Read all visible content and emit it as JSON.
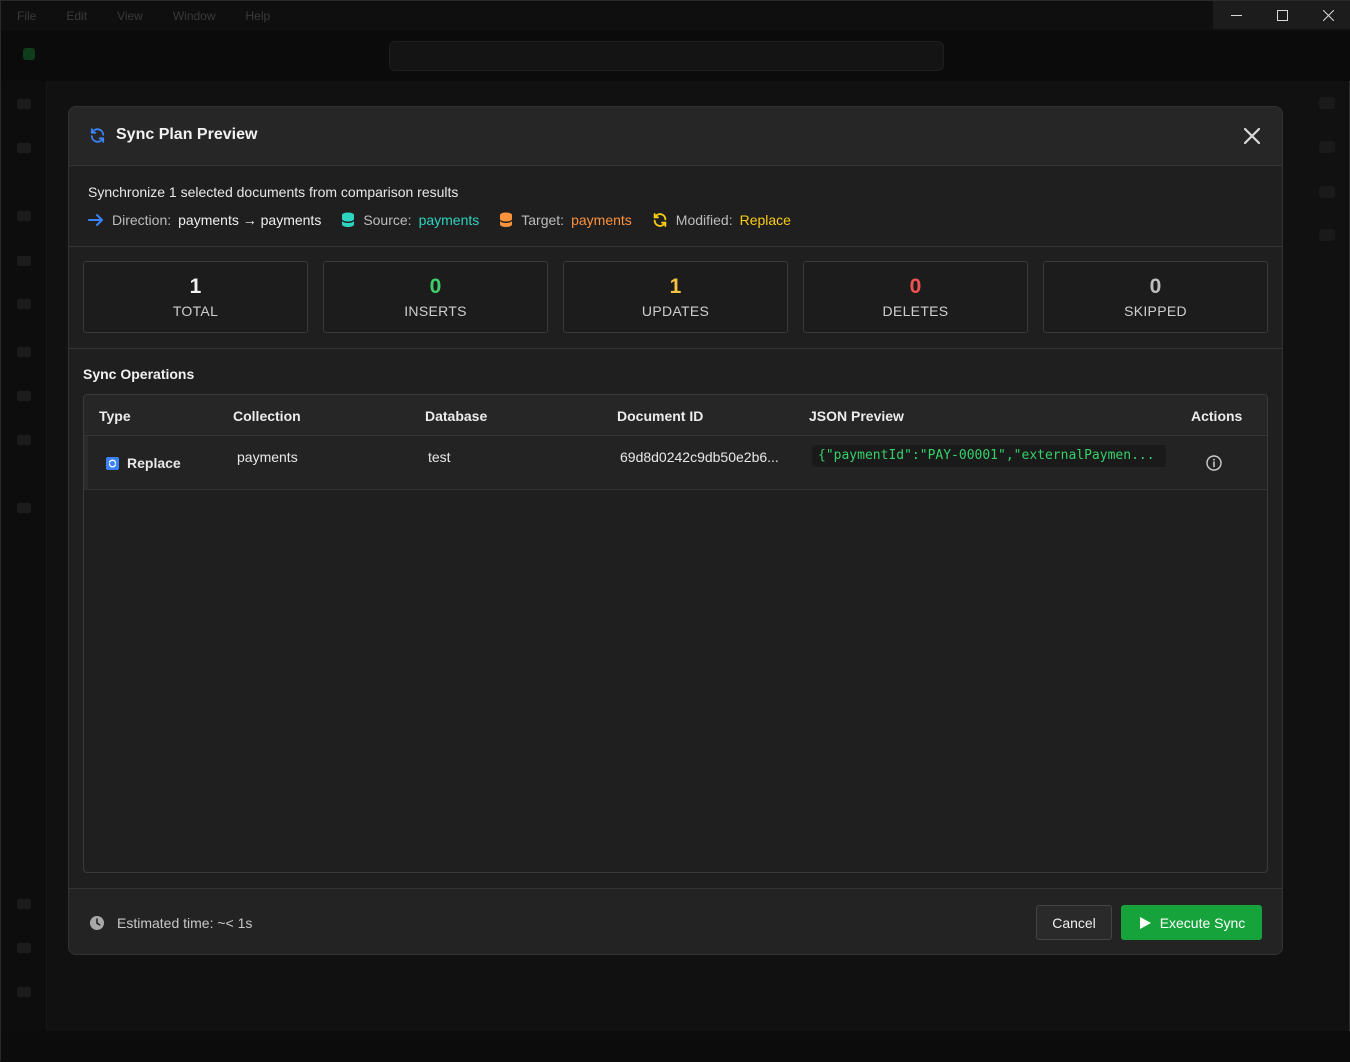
{
  "window": {
    "menu": [
      "File",
      "Edit",
      "View",
      "Window",
      "Help"
    ],
    "controls": {
      "minimize": "minimize",
      "maximize": "maximize",
      "close": "close"
    }
  },
  "modal": {
    "title": "Sync Plan Preview",
    "icon": "sync-icon",
    "summary": "Synchronize 1 selected documents from comparison results",
    "meta": {
      "direction_label": "Direction:",
      "direction_value": "payments → payments",
      "source_label": "Source:",
      "source_value": "payments",
      "target_label": "Target:",
      "target_value": "payments",
      "modified_label": "Modified:",
      "modified_value": "Replace"
    },
    "stats": [
      {
        "value": "1",
        "label": "TOTAL",
        "color": "#f2f2f2"
      },
      {
        "value": "0",
        "label": "INSERTS",
        "color": "#3ecf6a"
      },
      {
        "value": "1",
        "label": "UPDATES",
        "color": "#f5c242"
      },
      {
        "value": "0",
        "label": "DELETES",
        "color": "#f05252"
      },
      {
        "value": "0",
        "label": "SKIPPED",
        "color": "#bdbdbd"
      }
    ],
    "operations": {
      "title": "Sync Operations",
      "columns": [
        "Type",
        "Collection",
        "Database",
        "Document ID",
        "JSON Preview",
        "Actions"
      ],
      "rows": [
        {
          "type": "Replace",
          "collection": "payments",
          "database": "test",
          "document_id": "69d8d0242c9db50e2b6...",
          "json_preview": "{\"paymentId\":\"PAY-00001\",\"externalPaymen..."
        }
      ]
    },
    "footer": {
      "estimated": "Estimated time: ~< 1s",
      "cancel": "Cancel",
      "execute": "Execute Sync"
    }
  },
  "colors": {
    "accent_blue": "#3b82f6",
    "source_teal": "#2dd4bf",
    "target_orange": "#fb923c",
    "modified_yellow": "#facc15",
    "execute_green": "#17a33c",
    "json_green": "#35d06a"
  }
}
